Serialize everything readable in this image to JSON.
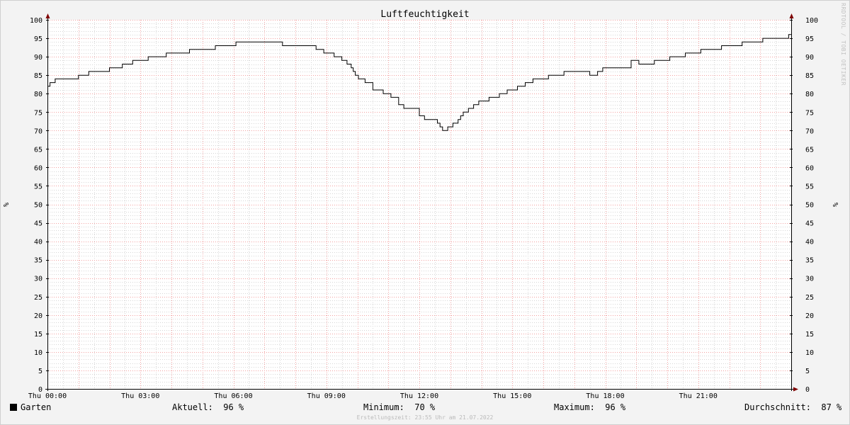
{
  "chart_data": {
    "type": "line",
    "title": "Luftfeuchtigkeit",
    "ylabel": "%",
    "ylim": [
      0,
      100
    ],
    "y_ticks": [
      "0",
      "5",
      "10",
      "15",
      "20",
      "25",
      "30",
      "35",
      "40",
      "45",
      "50",
      "55",
      "60",
      "65",
      "70",
      "75",
      "80",
      "85",
      "90",
      "95",
      "100"
    ],
    "xlim": [
      "Thu 00:00",
      "Thu 24:00"
    ],
    "x_ticks": [
      "Thu 00:00",
      "Thu 03:00",
      "Thu 06:00",
      "Thu 09:00",
      "Thu 12:00",
      "Thu 15:00",
      "Thu 18:00",
      "Thu 21:00"
    ],
    "grid": true,
    "series": [
      {
        "name": "Garten",
        "color": "#000000",
        "step": true,
        "x": [
          "00:00",
          "00:05",
          "00:15",
          "00:30",
          "01:00",
          "01:20",
          "02:00",
          "02:25",
          "02:45",
          "03:15",
          "03:50",
          "04:35",
          "05:25",
          "06:05",
          "07:35",
          "08:40",
          "08:55",
          "09:15",
          "09:30",
          "09:40",
          "09:48",
          "09:52",
          "09:56",
          "10:02",
          "10:08",
          "10:15",
          "10:30",
          "10:40",
          "10:50",
          "11:05",
          "11:20",
          "11:30",
          "12:00",
          "12:10",
          "12:20",
          "12:35",
          "12:40",
          "12:45",
          "12:50",
          "12:55",
          "13:05",
          "13:15",
          "13:20",
          "13:25",
          "13:35",
          "13:45",
          "13:55",
          "14:15",
          "14:35",
          "14:50",
          "15:10",
          "15:25",
          "15:40",
          "16:10",
          "16:40",
          "17:30",
          "17:45",
          "17:55",
          "18:50",
          "19:05",
          "19:35",
          "20:05",
          "20:35",
          "21:05",
          "21:45",
          "22:25",
          "23:05",
          "23:55"
        ],
        "values": [
          82,
          83,
          84,
          84,
          85,
          86,
          87,
          88,
          89,
          90,
          91,
          92,
          93,
          94,
          93,
          92,
          91,
          90,
          89,
          88,
          87,
          86,
          85,
          84,
          84,
          83,
          81,
          81,
          80,
          79,
          77,
          76,
          74,
          73,
          73,
          72,
          71,
          70,
          70,
          71,
          72,
          73,
          74,
          75,
          76,
          77,
          78,
          79,
          80,
          81,
          82,
          83,
          84,
          85,
          86,
          85,
          86,
          87,
          89,
          88,
          89,
          90,
          91,
          92,
          93,
          94,
          95,
          96
        ]
      }
    ]
  },
  "legend": {
    "series_name": "Garten",
    "current_label": "Aktuell:",
    "current_value": "96 %",
    "min_label": "Minimum:",
    "min_value": "70 %",
    "max_label": "Maximum:",
    "max_value": "96 %",
    "avg_label": "Durchschnitt:",
    "avg_value": "87 %"
  },
  "footer": "Erstellungszeit: 23:55 Uhr am 21.07.2022",
  "watermark": "RRDTOOL / TOBI OETIKER",
  "colors": {
    "major_grid": "#f2a0a0",
    "minor_grid": "#d6d6d6",
    "axis": "#000000",
    "arrow": "#800000",
    "line": "#000000",
    "background": "#f3f3f3",
    "plot_background": "#ffffff"
  }
}
